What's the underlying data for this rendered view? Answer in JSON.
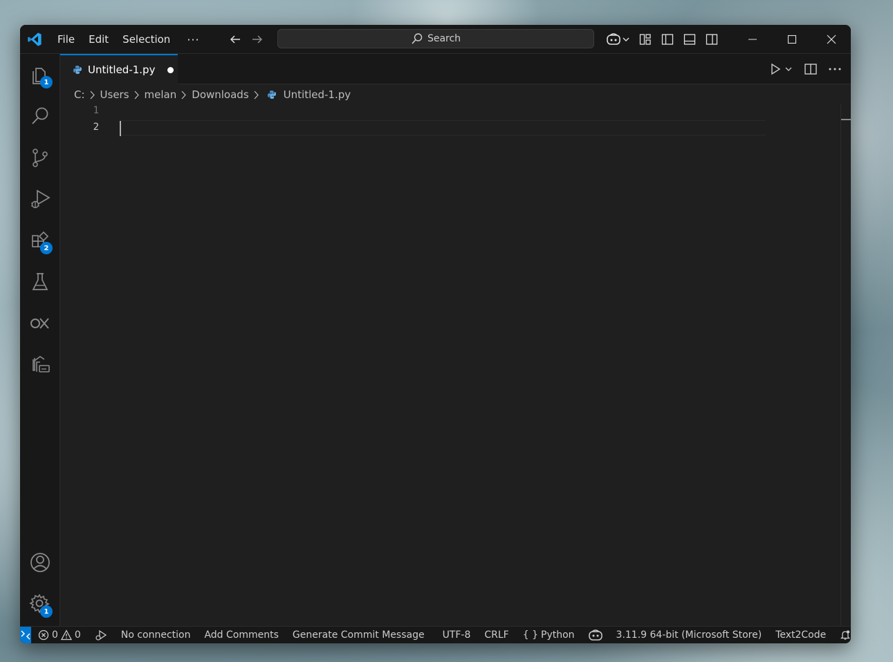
{
  "window": {
    "menu": [
      "File",
      "Edit",
      "Selection"
    ],
    "menu_more": "···",
    "search_label": "Search"
  },
  "activity": {
    "explorer_badge": "1",
    "extensions_badge": "2",
    "settings_badge": "1"
  },
  "tab": {
    "label": "Untitled-1.py"
  },
  "breadcrumb": [
    "C:",
    "Users",
    "melan",
    "Downloads",
    "Untitled-1.py"
  ],
  "editor": {
    "line_numbers": [
      "1",
      "2"
    ]
  },
  "statusbar": {
    "errors": "0",
    "warnings": "0",
    "no_connection": "No connection",
    "add_comments": "Add Comments",
    "generate_commit": "Generate Commit Message",
    "encoding": "UTF-8",
    "eol": "CRLF",
    "language_braces": "{ }",
    "language": "Python",
    "interpreter": "3.11.9 64-bit (Microsoft Store)",
    "text2code": "Text2Code"
  },
  "colors": {
    "accent": "#0078d4",
    "editor_bg": "#1f1f1f",
    "chrome_bg": "#181818"
  }
}
